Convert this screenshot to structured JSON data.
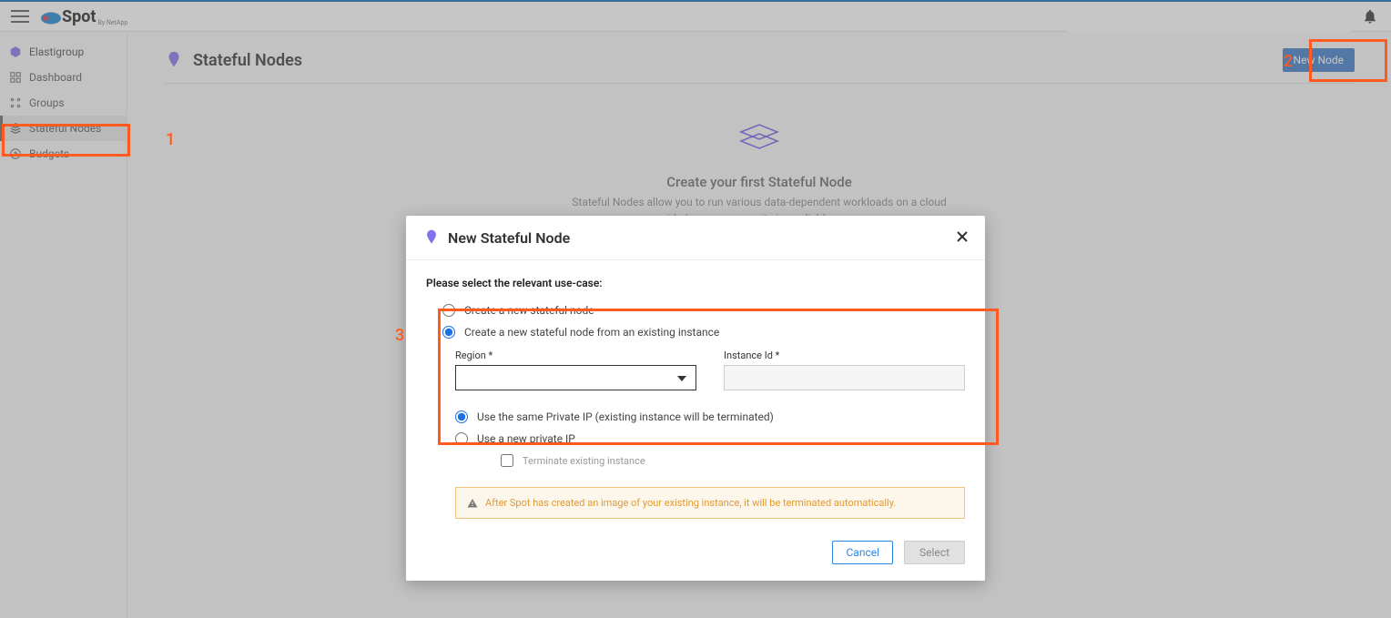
{
  "header": {
    "brand": "Spot",
    "brand_sub": "By NetApp"
  },
  "sidebar": {
    "category": "Elastigroup",
    "items": [
      {
        "label": "Dashboard"
      },
      {
        "label": "Groups"
      },
      {
        "label": "Stateful Nodes"
      },
      {
        "label": "Budgets"
      }
    ]
  },
  "page": {
    "title": "Stateful Nodes",
    "new_button": "New Node",
    "empty_title": "Create your first Stateful Node",
    "empty_desc": "Stateful Nodes allow you to run various data-dependent workloads on a cloud provider's excess capacity in a reliable manner,"
  },
  "modal": {
    "title": "New Stateful Node",
    "prompt": "Please select the relevant use-case:",
    "opt_new": "Create a new stateful node",
    "opt_existing": "Create a new stateful node from an existing instance",
    "region_label": "Region *",
    "instance_label": "Instance Id *",
    "ip_same": "Use the same Private IP (existing instance will be terminated)",
    "ip_new": "Use a new private IP",
    "terminate": "Terminate existing instance",
    "warning": "After Spot has created an image of your existing instance, it will be terminated automatically.",
    "cancel": "Cancel",
    "select": "Select"
  },
  "annotations": {
    "n1": "1",
    "n2": "2",
    "n3": "3"
  }
}
